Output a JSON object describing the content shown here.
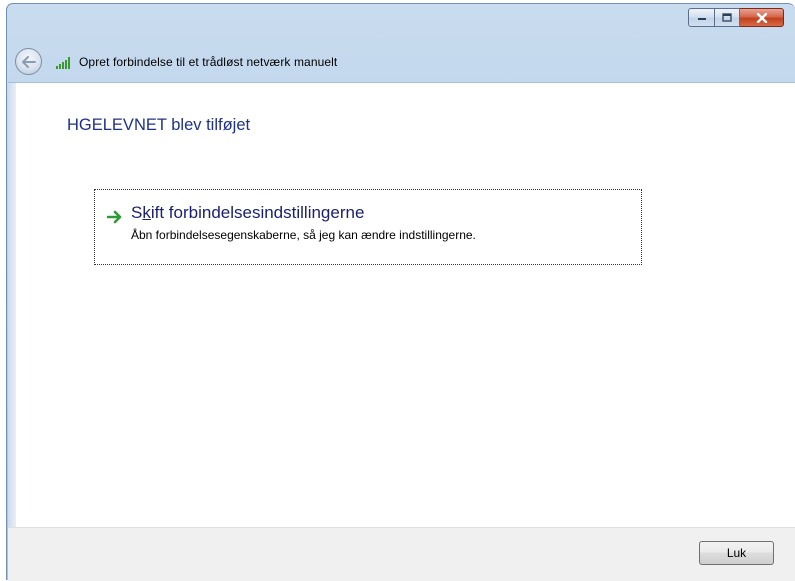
{
  "window": {
    "title": "Opret forbindelse til et trådløst netværk manuelt",
    "caption_buttons": [
      "minimize-icon",
      "maximize-icon",
      "close-icon"
    ]
  },
  "navbar": {
    "back_icon": "back-arrow-icon",
    "network_icon": "wifi-signal-icon"
  },
  "main": {
    "heading": "HGELEVNET blev tilføjet",
    "command_link": {
      "icon": "green-arrow-icon",
      "title_prefix": "S",
      "title_access_key": "k",
      "title_rest": "ift forbindelsesindstillingerne",
      "description": "Åbn forbindelsesegenskaberne, så jeg kan ændre indstillingerne."
    }
  },
  "footer": {
    "close_label": "Luk"
  },
  "colors": {
    "heading": "#1e3287",
    "close_button": "#c2401f",
    "arrow": "#2e9a36"
  }
}
